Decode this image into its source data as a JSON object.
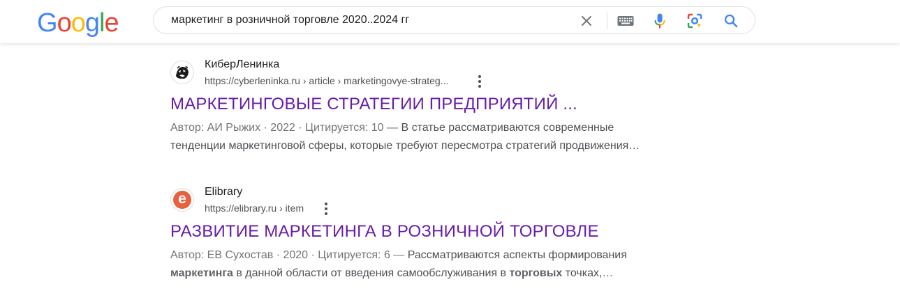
{
  "header": {
    "logo_letters": [
      {
        "ch": "G",
        "color": "#4285F4"
      },
      {
        "ch": "o",
        "color": "#EA4335"
      },
      {
        "ch": "o",
        "color": "#FBBC05"
      },
      {
        "ch": "g",
        "color": "#4285F4"
      },
      {
        "ch": "l",
        "color": "#34A853"
      },
      {
        "ch": "e",
        "color": "#EA4335"
      }
    ],
    "search_query": "маркетинг в розничной торговле 2020..2024 гг"
  },
  "results": [
    {
      "site_name": "КиберЛенинка",
      "url": "https://cyberleninka.ru › article › marketingovye-strateg...",
      "title": "МАРКЕТИНГОВЫЕ СТРАТЕГИИ ПРЕДПРИЯТИЙ ...",
      "meta": "Автор: АИ Рыжих · 2022 · Цитируется: 10 —",
      "snippet_line1": " В статье рассматриваются современные",
      "snippet_line2": "тенденции маркетинговой сферы, которые требуют пересмотра стратегий продвижения…"
    },
    {
      "site_name": "Elibrary",
      "url": "https://elibrary.ru › item",
      "favicon_letter": "e",
      "title": "РАЗВИТИЕ МАРКЕТИНГА В РОЗНИЧНОЙ ТОРГОВЛЕ",
      "meta": "Автор: ЕВ Сухостав · 2020 · Цитируется: 6 —",
      "snippet_a": " Рассматриваются аспекты формирования",
      "snippet_bold1": "маркетинга",
      "snippet_b": " в данной области от введения самообслуживания в ",
      "snippet_bold2": "торговых",
      "snippet_c": " точках,…"
    }
  ],
  "colors": {
    "link_visited": "#681da8",
    "elibrary_orange": "#e8613f"
  }
}
